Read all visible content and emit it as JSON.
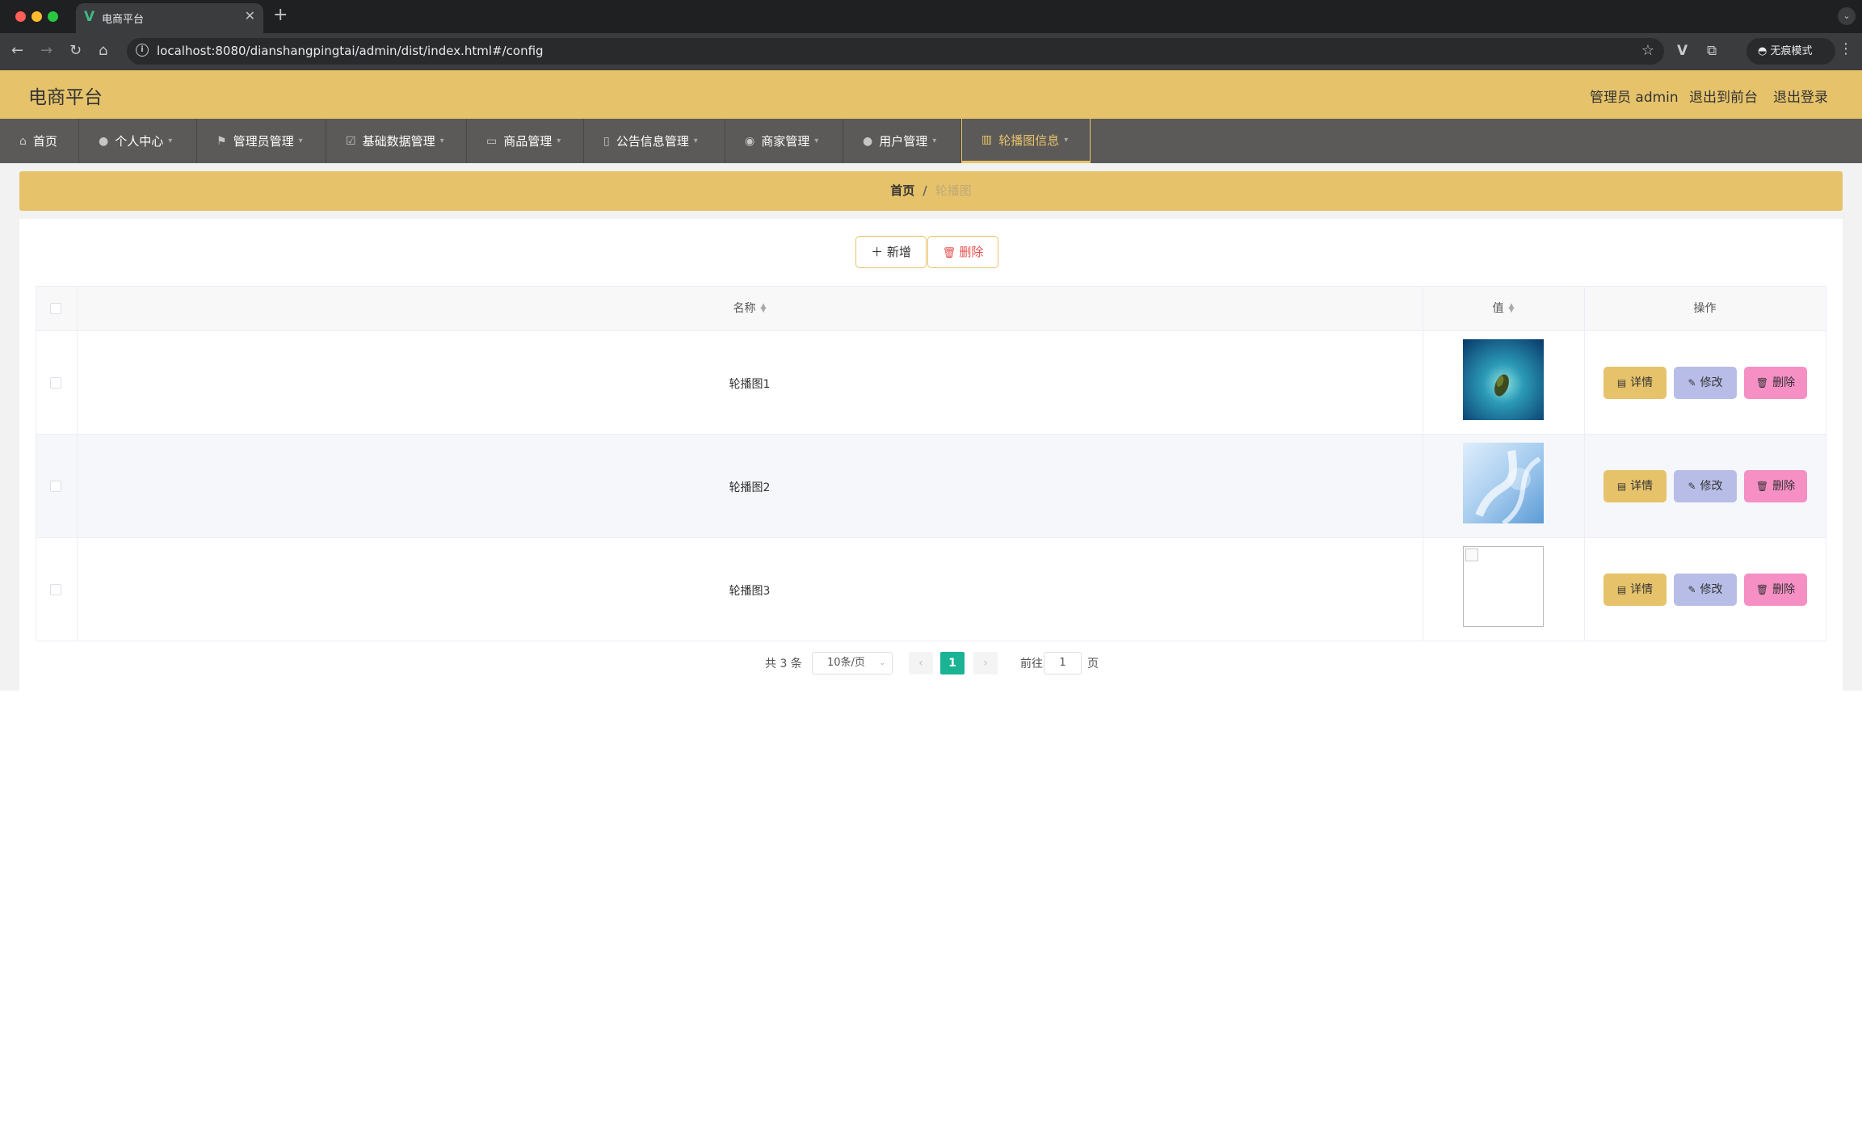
{
  "browser": {
    "tab_title": "电商平台",
    "url": "localhost:8080/dianshangpingtai/admin/dist/index.html#/config",
    "incognito_label": "无痕模式"
  },
  "header": {
    "title": "电商平台",
    "user_label": "管理员 admin",
    "to_front_label": "退出到前台",
    "logout_label": "退出登录"
  },
  "nav": {
    "items": [
      {
        "label": "首页",
        "icon": "home-icon"
      },
      {
        "label": "个人中心",
        "icon": "user-icon"
      },
      {
        "label": "管理员管理",
        "icon": "flag-icon"
      },
      {
        "label": "基础数据管理",
        "icon": "check-square-icon"
      },
      {
        "label": "商品管理",
        "icon": "credit-card-icon"
      },
      {
        "label": "公告信息管理",
        "icon": "microphone-icon"
      },
      {
        "label": "商家管理",
        "icon": "location-pin-icon"
      },
      {
        "label": "用户管理",
        "icon": "user-icon"
      },
      {
        "label": "轮播图信息",
        "icon": "bar-chart-icon",
        "active": true
      }
    ]
  },
  "breadcrumb": {
    "home": "首页",
    "separator": "/",
    "current": "轮播图"
  },
  "toolbar": {
    "add_label": "新增",
    "delete_label": "删除"
  },
  "table": {
    "columns": {
      "name": "名称",
      "value": "值",
      "actions": "操作"
    },
    "rows": [
      {
        "name": "轮播图1",
        "image": "ocean-island-image"
      },
      {
        "name": "轮播图2",
        "image": "blue-abstract-image"
      },
      {
        "name": "轮播图3",
        "image": "broken-image"
      }
    ],
    "actions": {
      "detail": "详情",
      "edit": "修改",
      "delete": "删除"
    }
  },
  "pagination": {
    "total": "共 3 条",
    "page_size": "10条/页",
    "current_page": "1",
    "goto_label": "前往",
    "goto_value": "1",
    "page_suffix": "页"
  },
  "colors": {
    "accent": "#e6c36b",
    "nav_bg": "#5c5a58",
    "pager_active": "#1ab394",
    "edit_btn": "#b8bde8",
    "delete_btn": "#f58fc4"
  }
}
